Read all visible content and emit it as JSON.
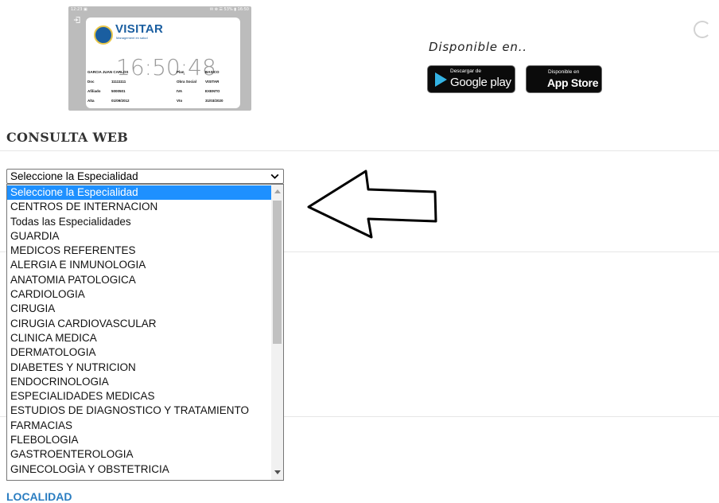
{
  "card": {
    "status_left": "12:23 ▣",
    "status_right": "✉ ⊗ ☰ 53% ▮ 16:50",
    "logo_text": "VISITAR",
    "logo_sub": "Management en salud",
    "clock": "16:50:48",
    "rows": [
      {
        "k1": "GARCIA JUAN CARLOS",
        "v1": "",
        "k2": "Plan",
        "v2": "BASICO"
      },
      {
        "k1": "Doc",
        "v1": "11111111",
        "k2": "Obra Social",
        "v2": "VISITAR"
      },
      {
        "k1": "Afiliado",
        "v1": "5000501",
        "k2": "IVA",
        "v2": "EXENTO"
      },
      {
        "k1": "Alta",
        "v1": "01/09/2012",
        "k2": "Vto",
        "v2": "31/03/2020"
      }
    ]
  },
  "disponible": "Disponible en..",
  "google_play": {
    "small": "Descargar de",
    "big": "Google play"
  },
  "app_store": {
    "small": "Disponible en",
    "big": "App Store"
  },
  "section_title": "CONSULTA WEB",
  "select": {
    "value": "Seleccione la Especialidad",
    "options": [
      "Seleccione la Especialidad",
      "CENTROS DE INTERNACION",
      "Todas las Especialidades",
      "GUARDIA",
      "MEDICOS REFERENTES",
      "ALERGIA E INMUNOLOGIA",
      "ANATOMIA PATOLOGICA",
      "CARDIOLOGIA",
      "CIRUGIA",
      "CIRUGIA CARDIOVASCULAR",
      "CLINICA MEDICA",
      "DERMATOLOGIA",
      "DIABETES Y NUTRICION",
      "ENDOCRINOLOGIA",
      "ESPECIALIDADES MEDICAS",
      "ESTUDIOS DE DIAGNOSTICO Y TRATAMIENTO",
      "FARMACIAS",
      "FLEBOLOGIA",
      "GASTROENTEROLOGIA",
      "GINECOLOGÌA Y OBSTETRICIA"
    ],
    "selected_index": 0
  },
  "localidad_label": "LOCALIDAD",
  "colors": {
    "accent": "#1e90ff",
    "link": "#2a7dc1",
    "logo": "#1a5ea0"
  }
}
